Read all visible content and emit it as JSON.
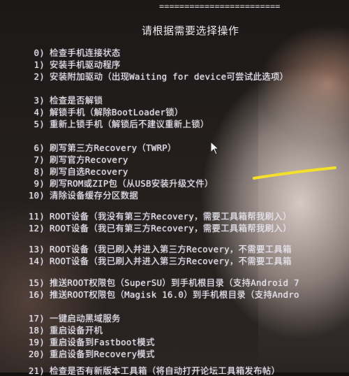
{
  "header": {
    "rule": "========================",
    "prompt": "请根据需要选择操作"
  },
  "menu": [
    {
      "n": "0)",
      "t": "检查手机连接状态"
    },
    {
      "n": "1)",
      "t": "安装手机驱动程序"
    },
    {
      "n": "2)",
      "t": "安装附加驱动（出现Waiting for device可尝试此选项）"
    },
    {
      "n": "3)",
      "t": "检查是否解锁"
    },
    {
      "n": "4)",
      "t": "解锁手机（解除BootLoader锁）"
    },
    {
      "n": "5)",
      "t": "重新上锁手机（解锁后不建议重新上锁）"
    },
    {
      "n": "6)",
      "t": "刷写第三方Recovery（TWRP）"
    },
    {
      "n": "7)",
      "t": "刷写官方Recovery"
    },
    {
      "n": "8)",
      "t": "刷写自选Recovery"
    },
    {
      "n": "9)",
      "t": "刷写ROM或ZIP包（从USB安装升级文件）"
    },
    {
      "n": "10)",
      "t": "清除设备缓存分区数据"
    },
    {
      "n": "11)",
      "t": "ROOT设备（我没有第三方Recovery，需要工具箱帮我刷入）"
    },
    {
      "n": "12)",
      "t": "ROOT设备（我已有第三方Recovery，需要工具箱帮我刷入）"
    },
    {
      "n": "13)",
      "t": "ROOT设备（我已刷入并进入第三方Recovery，不需要工具箱"
    },
    {
      "n": "14)",
      "t": "ROOT设备（我已刷入并进入第三方Recovery，不需要工具箱"
    },
    {
      "n": "15)",
      "t": "推送ROOT权限包（SuperSU）到手机根目录（支持Android 7"
    },
    {
      "n": "16)",
      "t": "推送ROOT权限包（Magisk 16.0）到手机根目录（支持Andro"
    },
    {
      "n": "17)",
      "t": "一键启动黑域服务"
    },
    {
      "n": "18)",
      "t": "重启设备开机"
    },
    {
      "n": "19)",
      "t": "重启设备到Fastboot模式"
    },
    {
      "n": "20)",
      "t": "重启设备到Recovery模式"
    },
    {
      "n": "21)",
      "t": "检查是否有新版本工具箱（将自动打开论坛工具箱发布帖）"
    }
  ],
  "colors": {
    "text": "#e9e6ee",
    "annotation": "#f2e02a",
    "background": "#141210"
  },
  "icons": {
    "cursor": "mouse-pointer-icon"
  }
}
